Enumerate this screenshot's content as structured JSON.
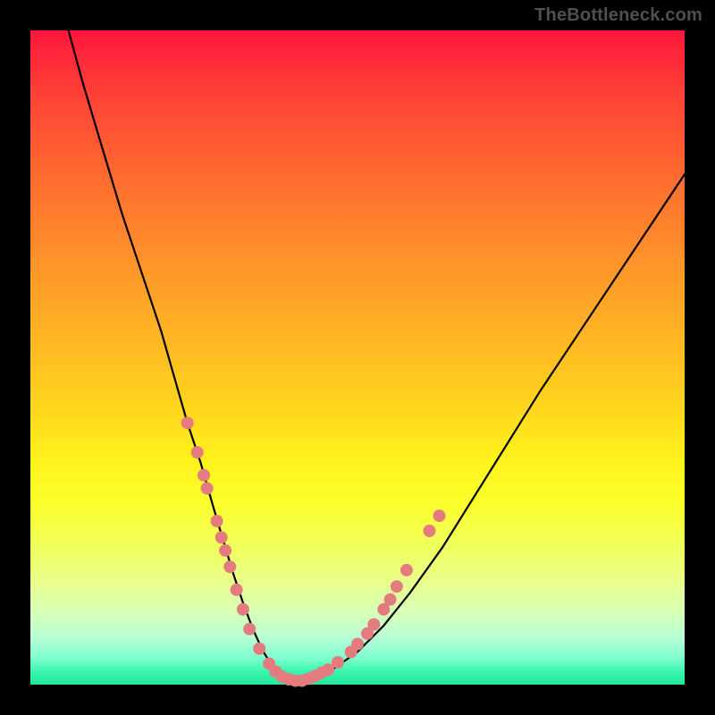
{
  "watermark": "TheBottleneck.com",
  "colors": {
    "frame": "#000000",
    "curve": "#000000",
    "dot": "#e47b7e",
    "gradient_top": "#ff163b",
    "gradient_bottom": "#20e89a"
  },
  "chart_data": {
    "type": "line",
    "title": "",
    "xlabel": "",
    "ylabel": "",
    "xlim": [
      0,
      100
    ],
    "ylim": [
      0,
      100
    ],
    "series": [
      {
        "name": "bottleneck-curve",
        "x": [
          5,
          8,
          11,
          14,
          17,
          20,
          22,
          24,
          26,
          28,
          29.5,
          31,
          32.5,
          34,
          35.5,
          37,
          39,
          41,
          43,
          46,
          50,
          54,
          58,
          63,
          68,
          73,
          78,
          84,
          90,
          96,
          100
        ],
        "y": [
          103,
          92,
          82,
          72,
          63,
          54,
          47,
          40,
          34,
          27,
          22,
          17,
          12.5,
          8.5,
          5.2,
          2.8,
          1.2,
          0.6,
          0.9,
          2.2,
          5,
          9,
          14,
          21,
          29,
          37,
          45,
          54,
          63,
          72,
          78
        ]
      }
    ],
    "scatter_points": [
      {
        "x": 24.0,
        "y": 40.0
      },
      {
        "x": 25.5,
        "y": 35.5
      },
      {
        "x": 26.5,
        "y": 32.0
      },
      {
        "x": 27.0,
        "y": 30.0
      },
      {
        "x": 28.5,
        "y": 25.0
      },
      {
        "x": 29.2,
        "y": 22.5
      },
      {
        "x": 29.8,
        "y": 20.5
      },
      {
        "x": 30.5,
        "y": 18.0
      },
      {
        "x": 31.5,
        "y": 14.5
      },
      {
        "x": 32.5,
        "y": 11.5
      },
      {
        "x": 33.5,
        "y": 8.5
      },
      {
        "x": 35.0,
        "y": 5.5
      },
      {
        "x": 36.5,
        "y": 3.2
      },
      {
        "x": 37.5,
        "y": 2.0
      },
      {
        "x": 38.5,
        "y": 1.2
      },
      {
        "x": 39.5,
        "y": 0.8
      },
      {
        "x": 40.5,
        "y": 0.6
      },
      {
        "x": 41.5,
        "y": 0.6
      },
      {
        "x": 42.5,
        "y": 0.9
      },
      {
        "x": 43.5,
        "y": 1.3
      },
      {
        "x": 44.5,
        "y": 1.8
      },
      {
        "x": 45.5,
        "y": 2.3
      },
      {
        "x": 47.0,
        "y": 3.4
      },
      {
        "x": 49.0,
        "y": 5.0
      },
      {
        "x": 50.0,
        "y": 6.2
      },
      {
        "x": 51.5,
        "y": 7.8
      },
      {
        "x": 52.5,
        "y": 9.2
      },
      {
        "x": 54.0,
        "y": 11.5
      },
      {
        "x": 55.0,
        "y": 13.0
      },
      {
        "x": 56.0,
        "y": 15.0
      },
      {
        "x": 57.5,
        "y": 17.5
      },
      {
        "x": 61.0,
        "y": 23.5
      },
      {
        "x": 62.5,
        "y": 25.8
      }
    ],
    "dot_radius_px": 7
  }
}
